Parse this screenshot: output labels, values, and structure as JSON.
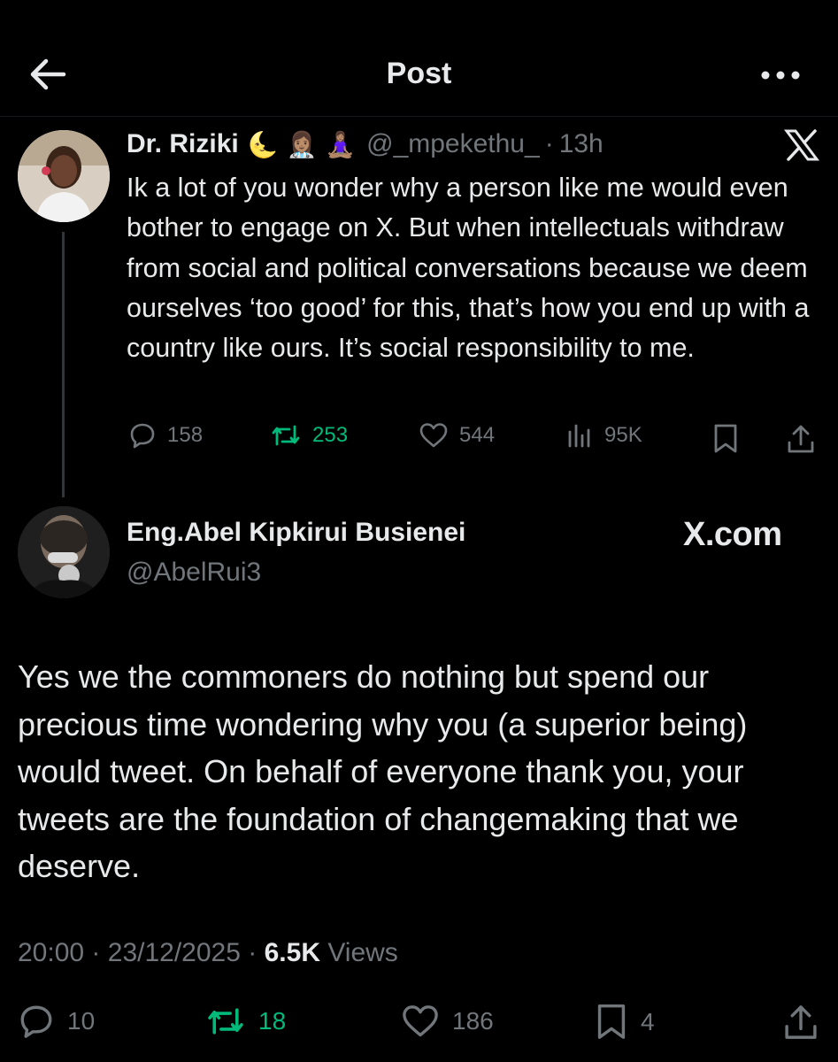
{
  "header": {
    "title": "Post"
  },
  "quoted_post": {
    "author_name": "Dr. Riziki",
    "name_emojis": "🌜 👩🏽‍⚕️ 🧘🏽‍♀️",
    "handle": "@_mpekethu_",
    "separator": "·",
    "time": "13h",
    "text": "Ik a lot of you wonder why a person like me would even bother to engage on X. But when intellectuals withdraw from social and political conversations because we deem ourselves ‘too good’ for this, that’s how you end up with a country like ours. It’s social responsibility to me.",
    "replies": "158",
    "reposts": "253",
    "likes": "544",
    "views": "95K"
  },
  "reply_post": {
    "author_name": "Eng.Abel Kipkirui Busienei",
    "handle": "@AbelRui3",
    "watermark": "X.com",
    "text": "Yes we the commoners do nothing but spend our precious time wondering why you (a superior being) would tweet. On behalf of everyone thank you, your tweets are the foundation of changemaking that we deserve.",
    "time": "20:00",
    "separator": "·",
    "date": "23/12/2025",
    "views_count": "6.5K",
    "views_label": "Views",
    "replies": "10",
    "reposts": "18",
    "likes": "186",
    "bookmarks": "4"
  },
  "colors": {
    "background": "#000000",
    "text_primary": "#e7e9ea",
    "text_secondary": "#71767b",
    "repost_active": "#00ba7c"
  }
}
